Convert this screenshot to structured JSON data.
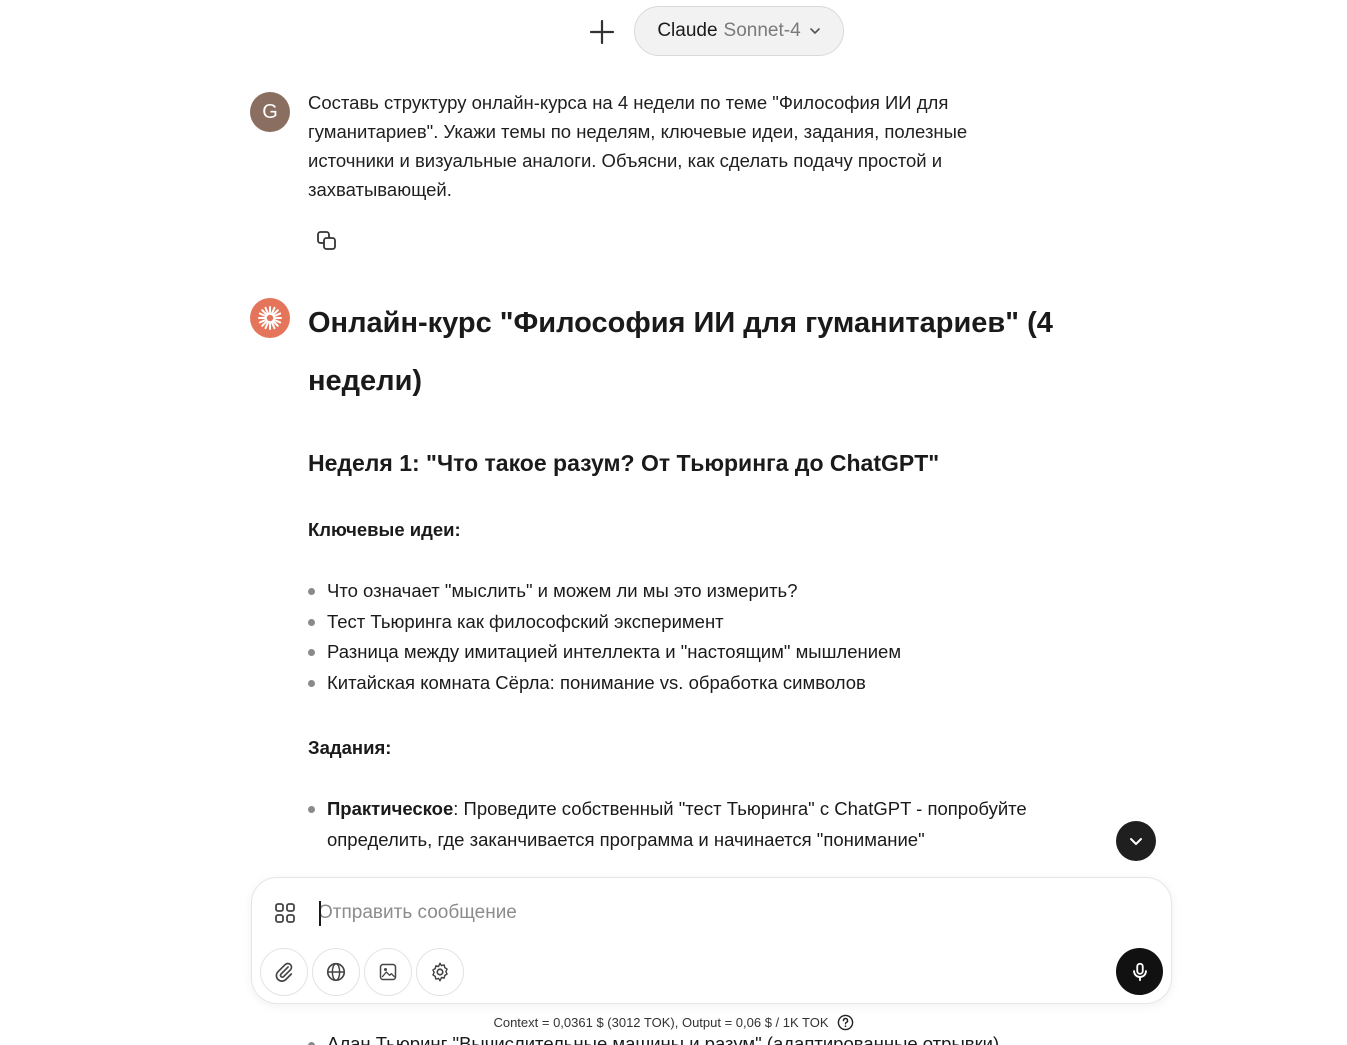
{
  "header": {
    "model_brand": "Claude",
    "model_name": "Sonnet-4"
  },
  "user_message": {
    "avatar_letter": "G",
    "text": "Составь структуру онлайн-курса на 4 недели по теме \"Философия ИИ для гуманитариев\". Укажи темы по неделям, ключевые идеи, задания, полезные источники и визуальные аналоги. Объясни, как сделать подачу простой и захватывающей."
  },
  "answer": {
    "title": "Онлайн-курс \"Философия ИИ для гуманитариев\" (4 недели)",
    "week1_title": "Неделя 1: \"Что такое разум? От Тьюринга до ChatGPT\"",
    "key_ideas_label": "Ключевые идеи:",
    "key_ideas": [
      "Что означает \"мыслить\" и можем ли мы это измерить?",
      "Тест Тьюринга как философский эксперимент",
      "Разница между имитацией интеллекта и \"настоящим\" мышлением",
      "Китайская комната Сёрла: понимание vs. обработка символов"
    ],
    "tasks_label": "Задания:",
    "task1_bold": "Практическое",
    "task1_text": ": Проведите собственный \"тест Тьюринга\" с ChatGPT - попробуйте определить, где заканчивается программа и начинается \"понимание\"",
    "cut_item": "Алан Тьюринг \"Вычислительные машины и разум\" (адаптированные отрывки)"
  },
  "composer": {
    "placeholder": "Отправить сообщение"
  },
  "footer": {
    "cost_note": "Context = 0,0361 $ (3012 TOK), Output = 0,06 $ / 1K TOK"
  },
  "colors": {
    "ai_avatar": "#e4755a",
    "user_avatar": "#8a6e5f",
    "primary_dark": "#111111"
  }
}
